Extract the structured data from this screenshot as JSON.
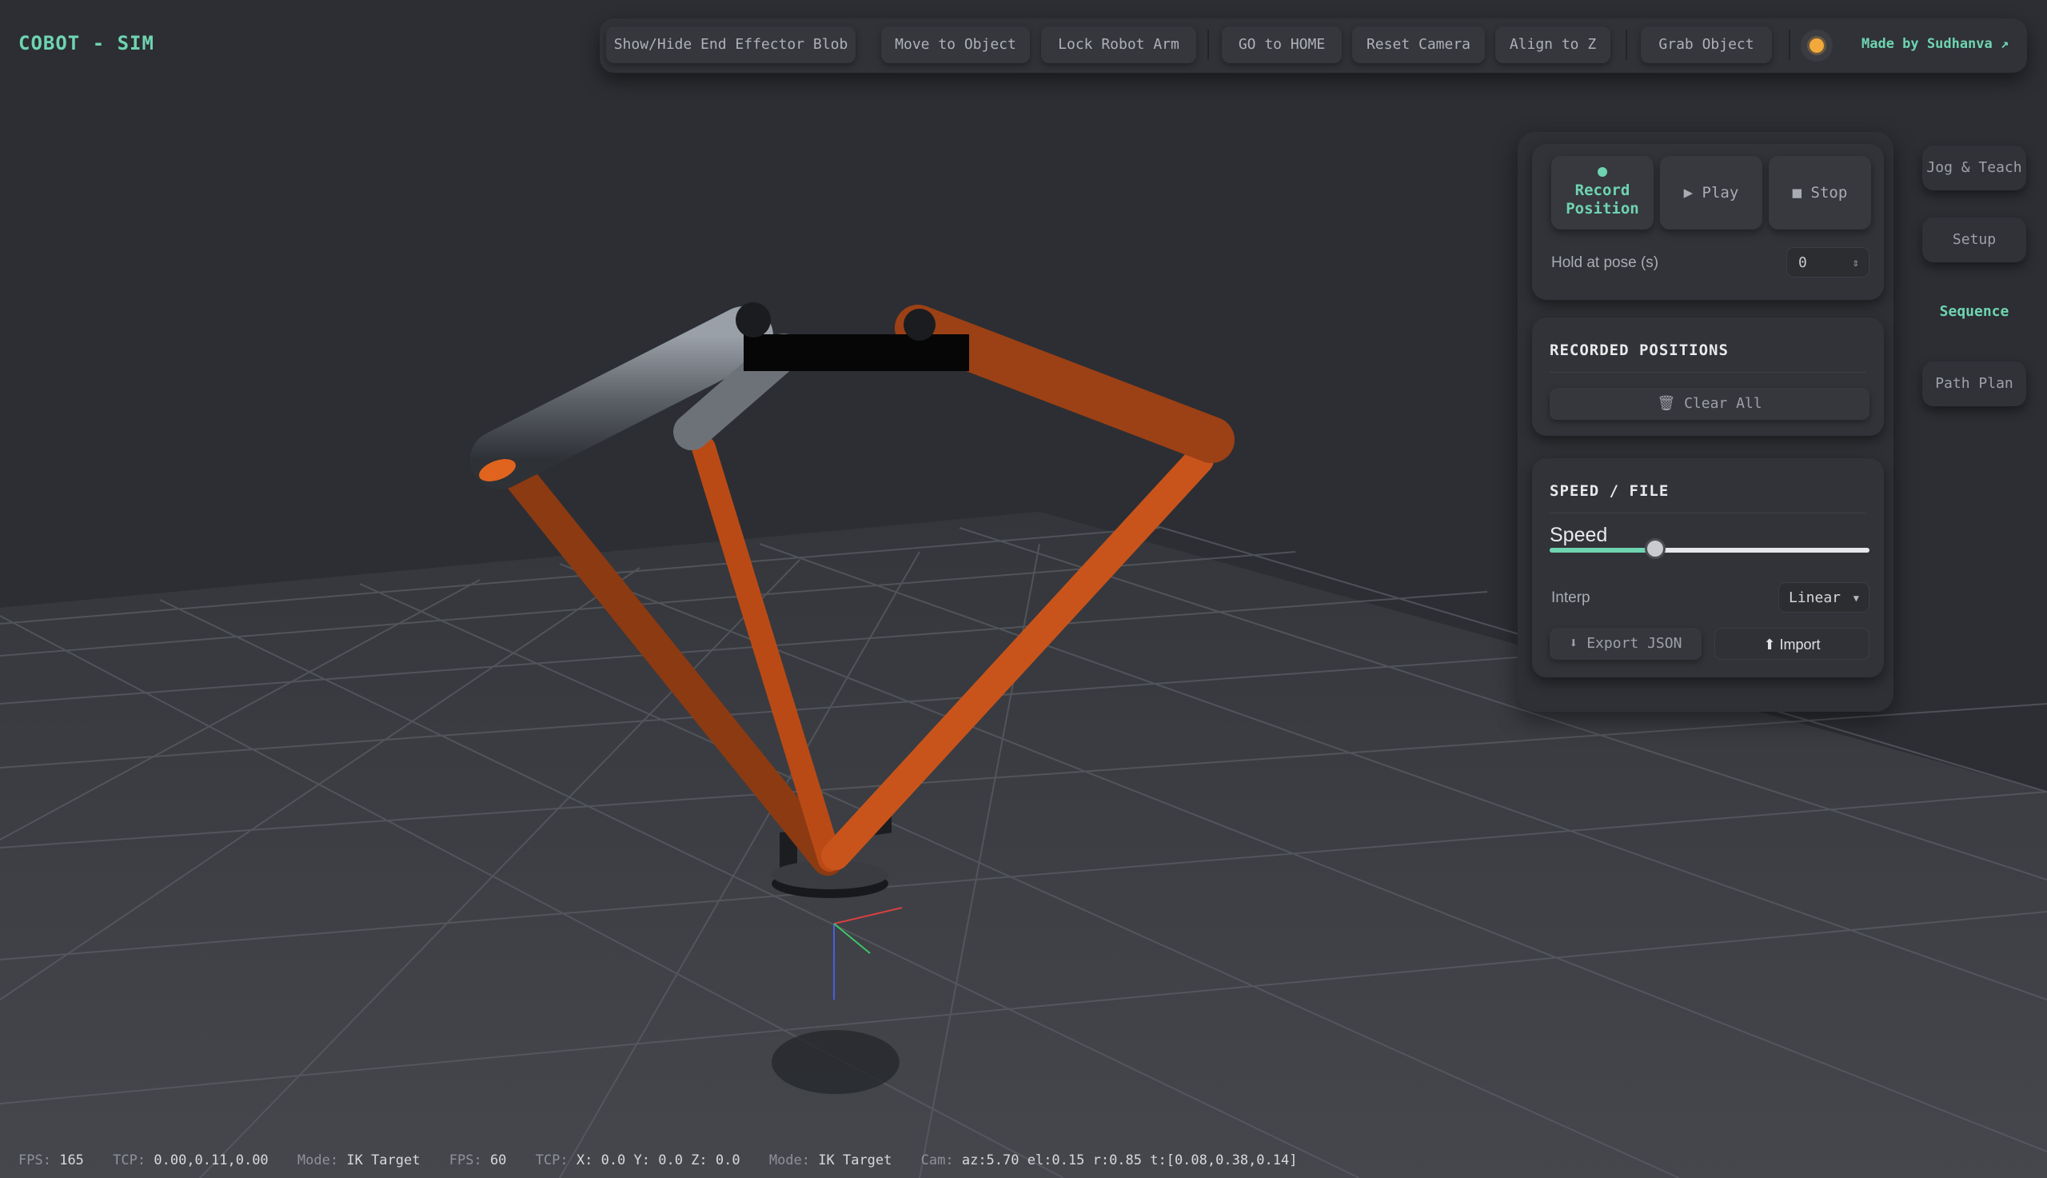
{
  "app": {
    "title": "COBOT - SIM"
  },
  "toolbar": {
    "buttons": [
      "Show/Hide End Effector Blob",
      "Move to Object",
      "Lock Robot Arm",
      "GO to HOME",
      "Reset Camera",
      "Align to Z",
      "Grab Object"
    ],
    "theme_icon": "sun-icon",
    "credit": "Made by Sudhanva ↗"
  },
  "sequence": {
    "record_label_1": "Record",
    "record_label_2": "Position",
    "play_label": "▶ Play",
    "stop_label": "■ Stop",
    "hold_label": "Hold at pose (s)",
    "hold_value": "0",
    "recorded_heading": "RECORDED POSITIONS",
    "clear_label": "🗑 Clear All",
    "speed_file_heading": "SPEED / FILE",
    "speed_label": "Speed",
    "speed_fraction": 0.33,
    "interp_label": "Interp",
    "interp_value": "Linear",
    "export_label": "⬇ Export JSON",
    "import_label": "⬆ Import"
  },
  "tabs": [
    "Jog & Teach",
    "Setup",
    "Sequence",
    "Path Plan"
  ],
  "active_tab": "Sequence",
  "status": {
    "fps1_label": "FPS:",
    "fps1_value": "165",
    "tcp1_label": "TCP:",
    "tcp1_value": "0.00,0.11,0.00",
    "mode1_label": "Mode:",
    "mode1_value": "IK Target",
    "fps2_label": "FPS:",
    "fps2_value": "60",
    "tcp2_label": "TCP:",
    "tcp2_value": "X: 0.0 Y: 0.0 Z: 0.0",
    "mode2_label": "Mode:",
    "mode2_value": "IK Target",
    "cam_label": "Cam:",
    "cam_value": "az:5.70 el:0.15 r:0.85 t:[0.08,0.38,0.14]"
  },
  "colors": {
    "accent": "#6fd4b0",
    "arm_orange": "#c4501a",
    "background": "#2c2e33"
  }
}
